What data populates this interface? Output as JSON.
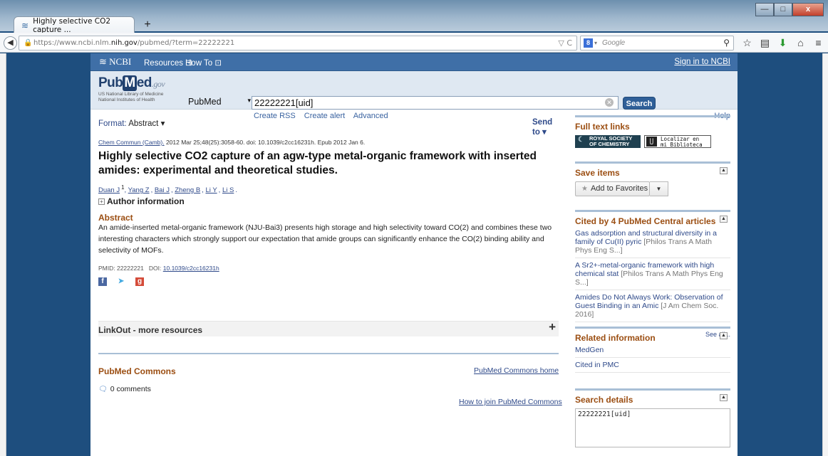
{
  "browser": {
    "tab_title": "Highly selective CO2 capture ...",
    "new_tab": "+",
    "url_prefix": "https://www.ncbi.nlm.",
    "url_domain": "nih.gov",
    "url_path": "/pubmed/?term=22222221",
    "search_engine": "Google",
    "win_min": "—",
    "win_max": "□",
    "win_close": "x"
  },
  "ncbi": {
    "logo": "NCBI",
    "resources": "Resources",
    "howto": "How To",
    "signin": "Sign in to NCBI"
  },
  "header": {
    "logo_pub": "Pub",
    "logo_m": "M",
    "logo_ed": "ed",
    "logo_gov": ".gov",
    "sub1": "US National Library of Medicine",
    "sub2": "National Institutes of Health",
    "db": "PubMed",
    "query": "22222221[uid]",
    "search_btn": "Search",
    "links": [
      "Create RSS",
      "Create alert",
      "Advanced"
    ],
    "help": "Help"
  },
  "article": {
    "format_label": "Format:",
    "format_value": "Abstract",
    "send_to": "Send to",
    "journal": "Chem Commun (Camb).",
    "citation": " 2012 Mar 25;48(25):3058-60. doi: 10.1039/c2cc16231h. Epub 2012 Jan 6.",
    "title": "Highly selective CO2 capture of an agw-type metal-organic framework with inserted amides: experimental and theoretical studies.",
    "authors": [
      "Duan J",
      "Yang Z",
      "Bai J",
      "Zheng B",
      "Li Y",
      "Li S"
    ],
    "author_sup": "1",
    "author_info": "Author information",
    "abstract_heading": "Abstract",
    "abstract": "An amide-inserted metal-organic framework (NJU-Bai3) presents high storage and high selectivity toward CO(2) and combines these two interesting characters which strongly support our expectation that amide groups can significantly enhance the CO(2) binding ability and selectivity of MOFs.",
    "pmid_label": "PMID: 22222221",
    "doi_label": "DOI:",
    "doi": "10.1039/c2cc16231h",
    "linkout": "LinkOut - more resources",
    "commons_heading": "PubMed Commons",
    "commons_home": "PubMed Commons home",
    "comments": "0 comments",
    "join": "How to join PubMed Commons"
  },
  "sidebar": {
    "fulltext_heading": "Full text links",
    "rsc_line1": "ROYAL SOCIETY",
    "rsc_line2": "OF CHEMISTRY",
    "lib_line1": "Localizar en",
    "lib_line2": "mi Biblioteca",
    "save_heading": "Save items",
    "add_fav": "Add to Favorites",
    "cited_heading": "Cited by 4 PubMed Central articles",
    "cited": [
      {
        "title": "Gas adsorption and structural diversity in a family of Cu(II) pyric",
        "src": " [Philos Trans A Math Phys Eng S...]"
      },
      {
        "title": "A Sr2+-metal-organic framework with high chemical stat",
        "src": " [Philos Trans A Math Phys Eng S...]"
      },
      {
        "title": "Amides Do Not Always Work: Observation of Guest Binding in an Amic",
        "src": " [J Am Chem Soc. 2016]"
      }
    ],
    "see_all": "See all...",
    "related_heading": "Related information",
    "related": [
      "MedGen",
      "Cited in PMC"
    ],
    "details_heading": "Search details",
    "details_query": "22222221[uid]"
  }
}
